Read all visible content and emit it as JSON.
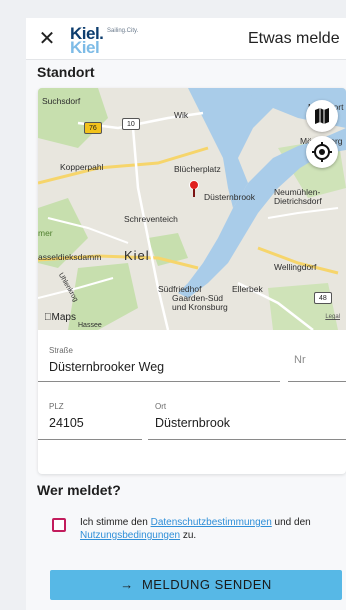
{
  "header": {
    "close_icon": "close-icon",
    "logo_main": "Kiel.",
    "logo_shadow": "Kiel",
    "logo_tagline": "Sailing.City.",
    "title": "Etwas melde"
  },
  "location": {
    "section_title": "Standort",
    "map": {
      "labels": [
        "Suchsdorf",
        "Wik",
        "Möltenort",
        "Mönkeberg",
        "Kopperpahl",
        "Blücherplatz",
        "Düsternbrook",
        "Neumühlen-Dietrichsdorf",
        "Schreventeich",
        "mer",
        "asseldieksdamm",
        "Kiel",
        "Wellingdorf",
        "Südfriedhof",
        "Ellerbek",
        "Gaarden-Süd und Kronsburg",
        "Uhlenkrog",
        "Hassee"
      ],
      "road_badges": [
        "76",
        "10",
        "48"
      ],
      "attribution": "Maps",
      "legal": "Legal",
      "map_type_icon": "map-icon",
      "locate_icon": "location-target-icon",
      "pin_icon": "map-pin-icon"
    },
    "fields": {
      "street_label": "Straße",
      "street_value": "Düsternbrooker Weg",
      "number_placeholder": "Nr",
      "zip_label": "PLZ",
      "zip_value": "24105",
      "city_label": "Ort",
      "city_value": "Düsternbrook"
    }
  },
  "reporter": {
    "section_title": "Wer meldet?",
    "consent_prefix": "Ich stimme den ",
    "privacy_link": "Datenschutzbestimmungen",
    "consent_middle": " und den ",
    "terms_link": "Nutzungsbedingungen",
    "consent_suffix": " zu.",
    "checked": false
  },
  "submit": {
    "icon": "arrow-right-icon",
    "label": "MELDUNG SENDEN"
  },
  "colors": {
    "brand_dark": "#0d3d6e",
    "brand_light": "#6fb4e4",
    "accent": "#57b8e6",
    "link": "#2f8fd8",
    "checkbox": "#c21c5c",
    "water": "#a9cce9",
    "land": "#e8e6de",
    "green": "#c7dfae",
    "pin": "#e0201f"
  }
}
